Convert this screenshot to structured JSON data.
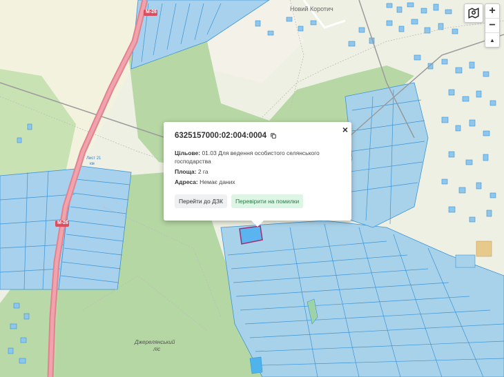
{
  "popup": {
    "cadastral_number": "6325157000:02:004:0004",
    "purpose_label": "Цільове:",
    "purpose_value": "01.03 Для ведення особистого селянського господарства",
    "area_label": "Площа:",
    "area_value": "2 га",
    "address_label": "Адреса:",
    "address_value": "Немає даних",
    "btn_dzk": "Перейти до ДЗК",
    "btn_check": "Перевірити на помилки",
    "close": "×"
  },
  "map_labels": {
    "road_m26_top": "M-26",
    "road_m26_mid": "M-26",
    "km_label_1": "Лист 21",
    "km_label_2": "км",
    "village": "Новий Коротич",
    "forest": "Джерелянський",
    "forest_2": "ліс"
  },
  "controls": {
    "zoom_in": "+",
    "zoom_out": "−",
    "north": "▲"
  },
  "icons": {
    "layers": "layers-icon",
    "copy": "copy-icon"
  },
  "colors": {
    "parcel_fill": "#a9d3ea",
    "parcel_stroke": "#3a93d6",
    "forest": "#b4d6a2",
    "road": "#e68996",
    "selected": "#5ab4f0"
  }
}
